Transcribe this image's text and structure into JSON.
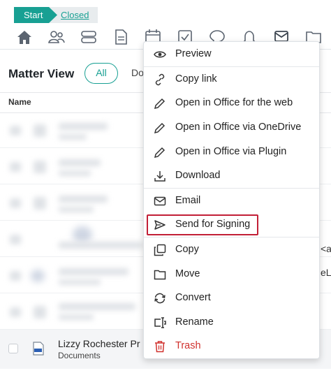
{
  "breadcrumb": {
    "start": "Start",
    "closed": "Closed"
  },
  "toolbar": {
    "icons": [
      "home-icon",
      "people-icon",
      "layers-icon",
      "document-icon",
      "calendar-icon",
      "checkbox-icon",
      "chat-icon",
      "bell-icon",
      "signing-icon",
      "folder-icon"
    ]
  },
  "matter": {
    "title": "Matter View",
    "filter_all": "All",
    "filter_docs": "Do"
  },
  "table": {
    "col_name": "Name",
    "right_fragments": [
      "<ac",
      "eLe"
    ],
    "last_row": {
      "title": "Lizzy Rochester Pr",
      "subtitle": "Documents"
    }
  },
  "menu": {
    "items": [
      {
        "label": "Preview",
        "icon": "eye-icon"
      },
      {
        "label": "Copy link",
        "icon": "link-icon"
      },
      {
        "label": "Open in Office for the web",
        "icon": "pencil-icon"
      },
      {
        "label": "Open in Office via OneDrive",
        "icon": "pencil-icon"
      },
      {
        "label": "Open in Office via Plugin",
        "icon": "pencil-icon"
      },
      {
        "label": "Download",
        "icon": "download-icon"
      },
      {
        "label": "Email",
        "icon": "envelope-icon"
      },
      {
        "label": "Send for Signing",
        "icon": "send-icon"
      },
      {
        "label": "Copy",
        "icon": "copy-icon"
      },
      {
        "label": "Move",
        "icon": "folder-icon"
      },
      {
        "label": "Convert",
        "icon": "refresh-icon"
      },
      {
        "label": "Rename",
        "icon": "rename-icon"
      },
      {
        "label": "Trash",
        "icon": "trash-icon"
      }
    ],
    "highlighted": "Send for Signing"
  },
  "colors": {
    "accent": "#18a093",
    "danger": "#d0312d",
    "highlight": "#c21f36"
  }
}
